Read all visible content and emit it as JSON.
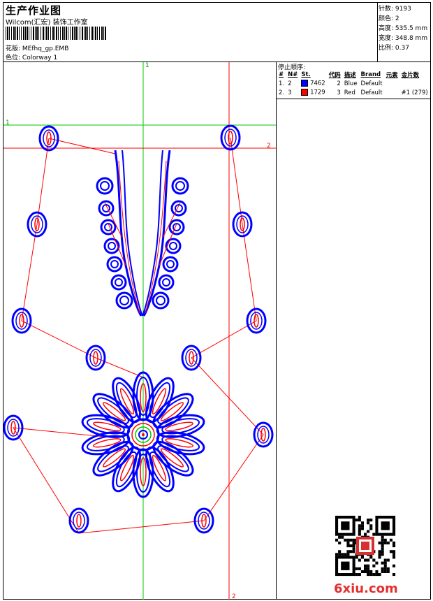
{
  "header": {
    "title": "生产作业图",
    "company": "Wilcom(汇宏) 装饰工作室",
    "design_label": "花版:",
    "design_name": "MEfhq_gp.EMB",
    "colorway_label": "色位:",
    "colorway_name": "Colorway 1"
  },
  "stats": [
    {
      "label": "针数:",
      "value": "9193"
    },
    {
      "label": "颜色:",
      "value": "2"
    },
    {
      "label": "高度:",
      "value": "535.5 mm"
    },
    {
      "label": "宽度:",
      "value": "348.8 mm"
    },
    {
      "label": "比例:",
      "value": "0.37"
    }
  ],
  "stop_sequence": {
    "title": "停止顺序:",
    "columns": [
      "#",
      "N#",
      "St.",
      "代码",
      "描述",
      "Brand",
      "元素",
      "金片数"
    ],
    "rows": [
      {
        "num": "1.",
        "n": "2",
        "color": "#0000ff",
        "code": "7462",
        "st": "2",
        "desc": "Blue",
        "brand": "Default",
        "element": "",
        "sequins": ""
      },
      {
        "num": "2.",
        "n": "3",
        "color": "#ff0000",
        "code": "1729",
        "st": "3",
        "desc": "Red",
        "brand": "Default",
        "element": "",
        "sequins": "#1 (279)"
      }
    ]
  },
  "guides": {
    "green_marker": "1",
    "red_marker": "2"
  },
  "watermark": "6xiu.com",
  "colors": {
    "blue": "#0000ff",
    "red": "#ff0000",
    "green": "#00c800"
  }
}
